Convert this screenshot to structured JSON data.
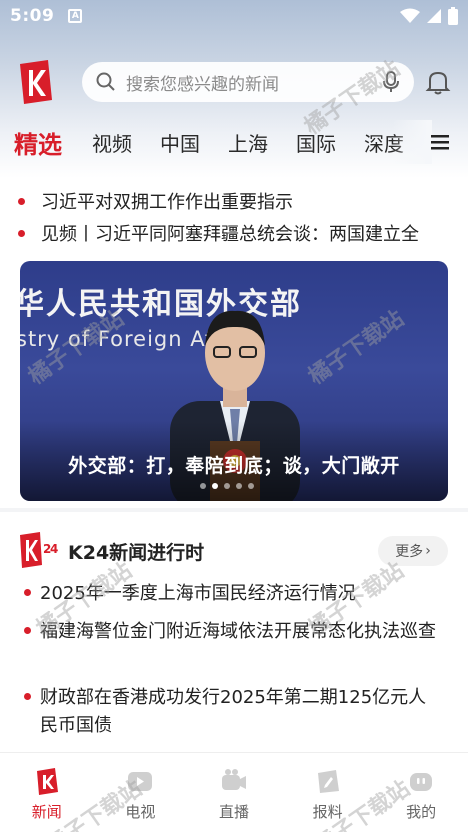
{
  "status_bar": {
    "time": "5:09",
    "notif": "A"
  },
  "header": {
    "search_placeholder": "搜索您感兴趣的新闻"
  },
  "tabs": [
    "精选",
    "视频",
    "中国",
    "上海",
    "国际",
    "深度"
  ],
  "headlines": [
    "习近平对双拥工作作出重要指示",
    "见频丨习近平同阿塞拜疆总统会谈：两国建立全"
  ],
  "banner": {
    "backdrop_line1": "华人民共和国外交部",
    "backdrop_line2": "stry of Foreign Affairs",
    "caption": "外交部：打，奉陪到底；谈，大门敞开",
    "pages": 5,
    "current_page": 1
  },
  "section": {
    "logo_text": "K24",
    "title": "K24新闻进行时",
    "more": "更多",
    "items": [
      "2025年一季度上海市国民经济运行情况",
      "福建海警位金门附近海域依法开展常态化执法巡查",
      "财政部在香港成功发行2025年第二期125亿元人民币国债"
    ]
  },
  "bottom_nav": [
    {
      "label": "新闻",
      "icon": "news-icon",
      "active": true
    },
    {
      "label": "电视",
      "icon": "tv-icon",
      "active": false
    },
    {
      "label": "直播",
      "icon": "live-camera-icon",
      "active": false
    },
    {
      "label": "报料",
      "icon": "report-icon",
      "active": false
    },
    {
      "label": "我的",
      "icon": "profile-icon",
      "active": false
    }
  ],
  "watermark": "橘子下载站",
  "colors": {
    "brand_red": "#d81e2a",
    "banner_blue": "#34449a"
  }
}
